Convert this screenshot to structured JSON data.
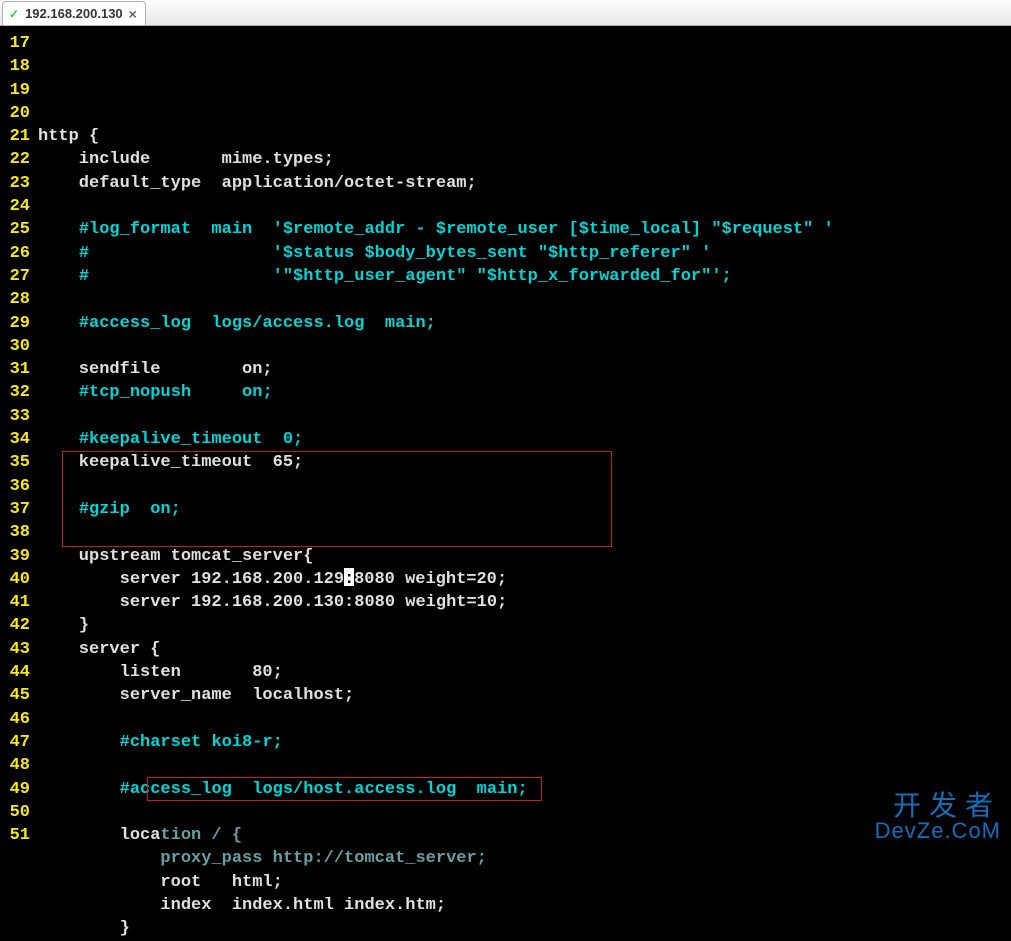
{
  "tab": {
    "title": "192.168.200.130",
    "icon": "✓",
    "close": "×"
  },
  "gutter": {
    "start": 17,
    "end": 51
  },
  "code": {
    "lines": [
      {
        "n": 17,
        "segs": [
          {
            "t": "http {",
            "c": "kw"
          }
        ]
      },
      {
        "n": 18,
        "segs": [
          {
            "t": "    include       mime.types;",
            "c": "kw"
          }
        ]
      },
      {
        "n": 19,
        "segs": [
          {
            "t": "    default_type  application/octet-stream;",
            "c": "kw"
          }
        ]
      },
      {
        "n": 20,
        "segs": []
      },
      {
        "n": 21,
        "segs": [
          {
            "t": "    ",
            "c": "kw"
          },
          {
            "t": "#log_format  main  '$remote_addr - $remote_user [$time_local] \"$request\" '",
            "c": "comment"
          }
        ]
      },
      {
        "n": 22,
        "segs": [
          {
            "t": "    ",
            "c": "kw"
          },
          {
            "t": "#                  '$status $body_bytes_sent \"$http_referer\" '",
            "c": "comment"
          }
        ]
      },
      {
        "n": 23,
        "segs": [
          {
            "t": "    ",
            "c": "kw"
          },
          {
            "t": "#                  '\"$http_user_agent\" \"$http_x_forwarded_for\"';",
            "c": "comment"
          }
        ]
      },
      {
        "n": 24,
        "segs": []
      },
      {
        "n": 25,
        "segs": [
          {
            "t": "    ",
            "c": "kw"
          },
          {
            "t": "#access_log  logs/access.log  main;",
            "c": "comment"
          }
        ]
      },
      {
        "n": 26,
        "segs": []
      },
      {
        "n": 27,
        "segs": [
          {
            "t": "    sendfile        on;",
            "c": "kw"
          }
        ]
      },
      {
        "n": 28,
        "segs": [
          {
            "t": "    ",
            "c": "kw"
          },
          {
            "t": "#tcp_nopush     on;",
            "c": "comment"
          }
        ]
      },
      {
        "n": 29,
        "segs": []
      },
      {
        "n": 30,
        "segs": [
          {
            "t": "    ",
            "c": "kw"
          },
          {
            "t": "#keepalive_timeout  0;",
            "c": "comment"
          }
        ]
      },
      {
        "n": 31,
        "segs": [
          {
            "t": "    keepalive_timeout  65;",
            "c": "kw"
          }
        ]
      },
      {
        "n": 32,
        "segs": []
      },
      {
        "n": 33,
        "segs": [
          {
            "t": "    ",
            "c": "kw"
          },
          {
            "t": "#gzip  on;",
            "c": "comment"
          }
        ]
      },
      {
        "n": 34,
        "segs": []
      },
      {
        "n": 35,
        "segs": [
          {
            "t": "    upstream tomcat_server{",
            "c": "kw"
          }
        ]
      },
      {
        "n": 36,
        "segs": [
          {
            "t": "        server 192.168.200.129",
            "c": "kw"
          },
          {
            "t": ":",
            "cursor": true
          },
          {
            "t": "8080 weight=20;",
            "c": "kw"
          }
        ]
      },
      {
        "n": 37,
        "segs": [
          {
            "t": "        server 192.168.200.130:8080 weight=10;",
            "c": "kw"
          }
        ]
      },
      {
        "n": 38,
        "segs": [
          {
            "t": "    }",
            "c": "kw"
          }
        ]
      },
      {
        "n": 39,
        "segs": [
          {
            "t": "    server {",
            "c": "kw"
          }
        ]
      },
      {
        "n": 40,
        "segs": [
          {
            "t": "        listen       80;",
            "c": "kw"
          }
        ]
      },
      {
        "n": 41,
        "segs": [
          {
            "t": "        server_name  localhost;",
            "c": "kw"
          }
        ]
      },
      {
        "n": 42,
        "segs": []
      },
      {
        "n": 43,
        "segs": [
          {
            "t": "        ",
            "c": "kw"
          },
          {
            "t": "#charset koi8-r;",
            "c": "comment"
          }
        ]
      },
      {
        "n": 44,
        "segs": []
      },
      {
        "n": 45,
        "segs": [
          {
            "t": "        ",
            "c": "kw"
          },
          {
            "t": "#access_log  logs/host.access.log  main;",
            "c": "comment"
          }
        ]
      },
      {
        "n": 46,
        "segs": []
      },
      {
        "n": 47,
        "segs": [
          {
            "t": "        loca",
            "c": "kw"
          },
          {
            "t": "tion / {",
            "c": "dim-comment"
          }
        ]
      },
      {
        "n": 48,
        "segs": [
          {
            "t": "            proxy_pass http://tomcat_server;",
            "c": "dim-comment"
          }
        ]
      },
      {
        "n": 49,
        "segs": [
          {
            "t": "            root   html;",
            "c": "kw"
          }
        ]
      },
      {
        "n": 50,
        "segs": [
          {
            "t": "            index  index.html index.htm;",
            "c": "kw"
          }
        ]
      },
      {
        "n": 51,
        "segs": [
          {
            "t": "        }",
            "c": "kw"
          }
        ]
      }
    ]
  },
  "watermark": {
    "line1": "开发者",
    "line2": "DevZe.CoM"
  }
}
